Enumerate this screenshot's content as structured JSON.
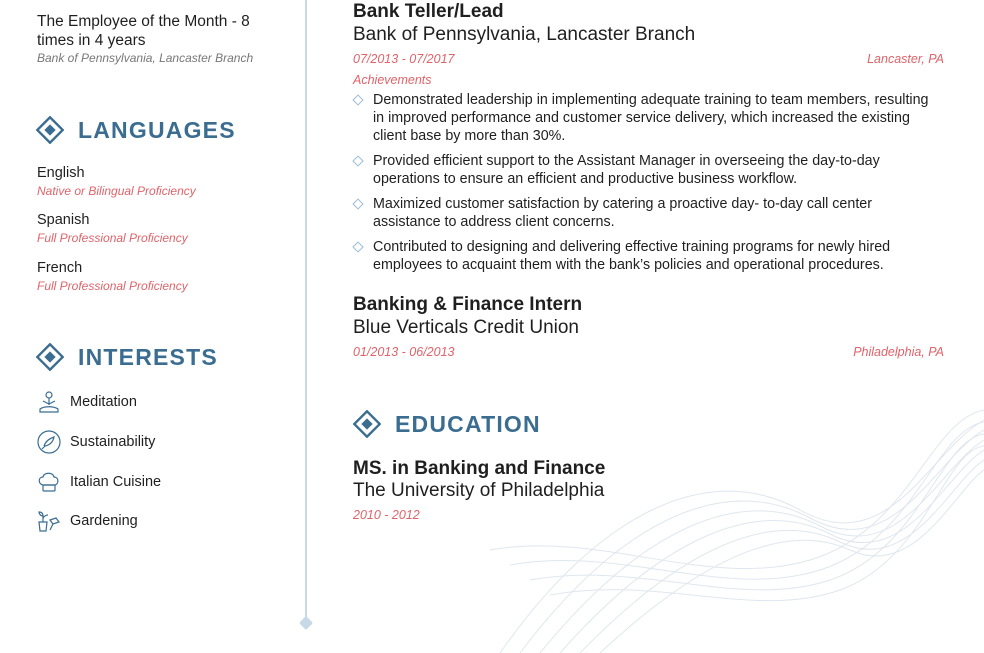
{
  "award": {
    "title": "The Employee of the Month - 8 times in 4 years",
    "org": "Bank of Pennsylvania, Lancaster Branch"
  },
  "languages": {
    "heading": "LANGUAGES",
    "items": [
      {
        "name": "English",
        "level": "Native or Bilingual Proficiency"
      },
      {
        "name": "Spanish",
        "level": "Full Professional Proficiency"
      },
      {
        "name": "French",
        "level": "Full Professional Proficiency"
      }
    ]
  },
  "interests": {
    "heading": "INTERESTS",
    "items": [
      {
        "label": "Meditation",
        "icon": "meditation-icon"
      },
      {
        "label": "Sustainability",
        "icon": "sustainability-icon"
      },
      {
        "label": "Italian Cuisine",
        "icon": "chef-hat-icon"
      },
      {
        "label": "Gardening",
        "icon": "gardening-icon"
      }
    ]
  },
  "experience": [
    {
      "title": "Bank Teller/Lead",
      "org": "Bank of Pennsylvania, Lancaster Branch",
      "dates": "07/2013 - 07/2017",
      "location": "Lancaster, PA",
      "achievements_label": "Achievements",
      "bullets": [
        "Demonstrated leadership in implementing adequate training to team members, resulting in improved performance and customer service delivery, which increased the existing client base by more than 30%.",
        "Provided efficient support to the Assistant Manager in overseeing the day-to-day operations to ensure an efficient and productive business workflow.",
        "Maximized customer satisfaction by catering a proactive day- to-day call center assistance to address client concerns.",
        "Contributed to designing and delivering effective training programs for newly hired employees to acquaint them with the bank’s policies and operational procedures."
      ]
    },
    {
      "title": "Banking & Finance Intern",
      "org": "Blue Verticals Credit Union",
      "dates": "01/2013 - 06/2013",
      "location": "Philadelphia, PA"
    }
  ],
  "education": {
    "heading": "EDUCATION",
    "degree": "MS. in Banking and Finance",
    "school": "The University of Philadelphia",
    "dates": "2010 - 2012"
  },
  "colors": {
    "accent": "#3b6d91",
    "highlight": "#e0636a",
    "divider": "#c7d8e6"
  }
}
